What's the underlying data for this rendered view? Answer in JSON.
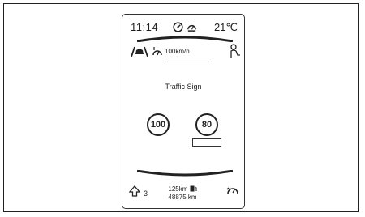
{
  "status": {
    "time": "11:14",
    "temperature": "21℃"
  },
  "assist": {
    "speed_limit": "100km/h"
  },
  "traffic_sign": {
    "title": "Traffic Sign",
    "signs": [
      {
        "value": "100"
      },
      {
        "value": "80"
      }
    ]
  },
  "footer": {
    "gear": "3",
    "range": "125km",
    "odometer": "48875 km"
  }
}
